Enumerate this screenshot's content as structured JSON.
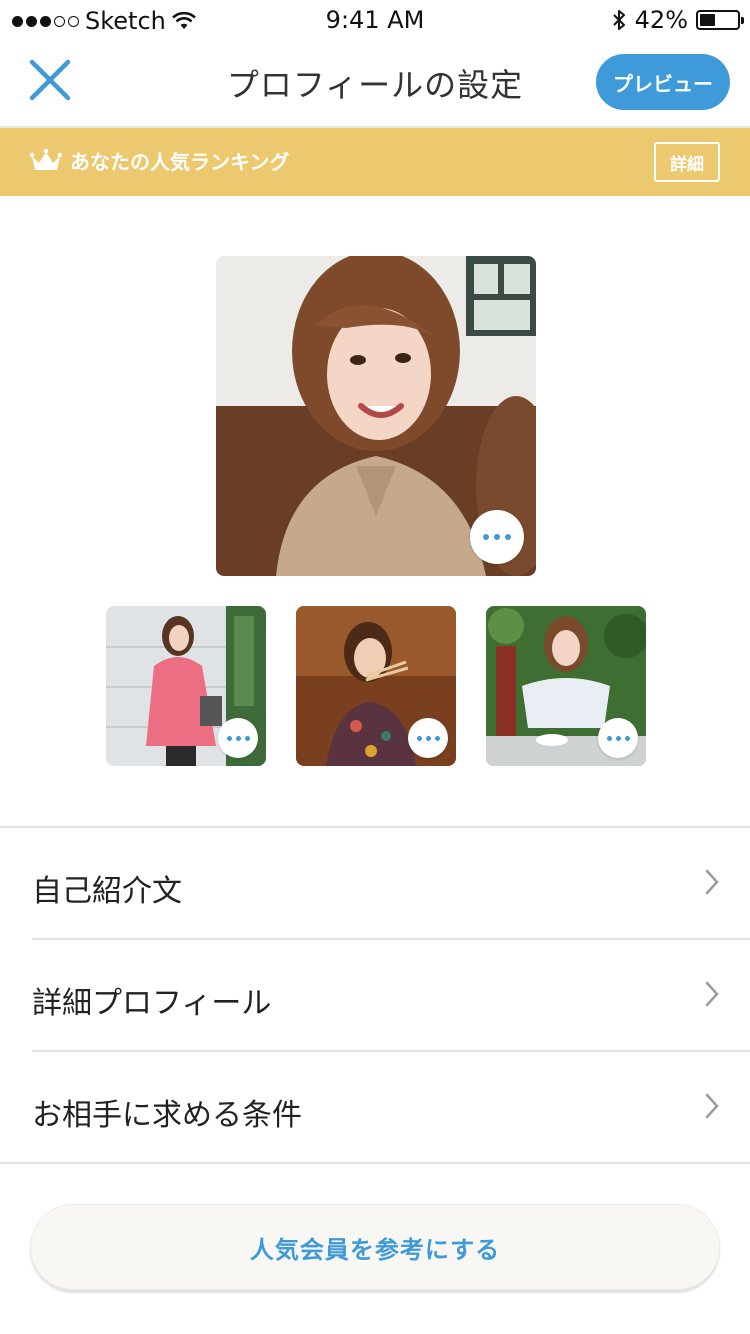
{
  "status_bar": {
    "carrier": "Sketch",
    "time": "9:41 AM",
    "battery_text": "42%",
    "battery_level": 0.42
  },
  "nav": {
    "title": "プロフィールの設定",
    "preview_label": "プレビュー",
    "close_icon": "close-icon"
  },
  "banner": {
    "text": "あなたの人気ランキング",
    "detail_label": "詳細",
    "icon": "crown-icon"
  },
  "photos": {
    "main_more_icon": "more-icon",
    "thumb_count": 3
  },
  "menu": {
    "items": [
      {
        "label": "自己紹介文"
      },
      {
        "label": "詳細プロフィール"
      },
      {
        "label": "お相手に求める条件"
      }
    ]
  },
  "reference_button": {
    "label": "人気会員を参考にする"
  },
  "colors": {
    "accent": "#3e9ad8",
    "banner": "#ecc86e",
    "divider": "#e2e2e2"
  }
}
